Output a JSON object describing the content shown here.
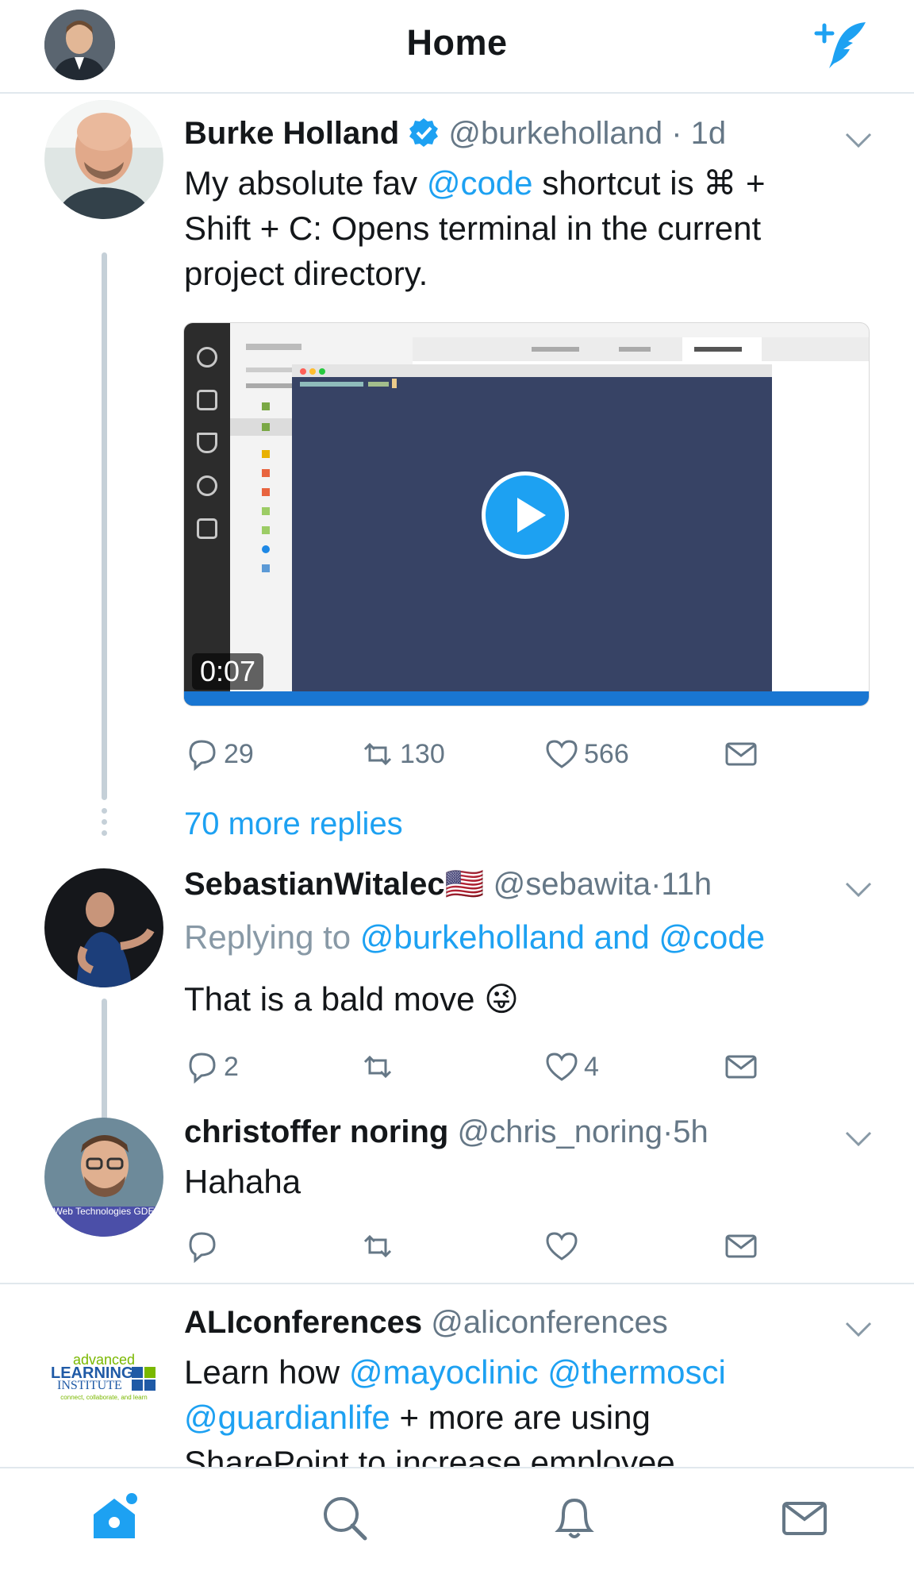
{
  "header": {
    "title": "Home"
  },
  "tweets": [
    {
      "name": "Burke Holland",
      "handle": "@burkeholland",
      "time": "1d",
      "text_parts": [
        "My absolute fav ",
        "@code",
        " shortcut is ⌘ +",
        "Shift + C: Opens terminal in the current",
        "project directory."
      ],
      "media": {
        "duration": "0:07"
      },
      "actions": {
        "replies": "29",
        "retweets": "130",
        "likes": "566"
      }
    },
    {
      "name": "SebastianWitalec🇺🇸",
      "handle": "@sebawita",
      "time": "11h",
      "replying_prefix": "Replying to ",
      "replying_to": "@burkeholland and @code",
      "text": "That is a bald move 😜",
      "actions": {
        "replies": "2",
        "retweets": "",
        "likes": "4"
      }
    },
    {
      "name": "christoffer noring",
      "handle": "@chris_noring",
      "time": "5h",
      "text": "Hahaha",
      "avatar_badge": "Web Technologies GDE",
      "actions": {
        "replies": "",
        "retweets": "",
        "likes": ""
      }
    },
    {
      "name": "ALIconferences",
      "handle": "@aliconferences",
      "text_parts": [
        "Learn how ",
        "@mayoclinic",
        " ",
        "@thermosci",
        "@guardianlife",
        " + more are using",
        "SharePoint to increase employee"
      ],
      "logo": {
        "line1": "advanced",
        "line2": "LEARNING",
        "line3": "INSTITUTE",
        "line4": "connect, collaborate, and learn"
      }
    }
  ],
  "more_replies": "70 more replies",
  "dot": "·",
  "colors": {
    "accent": "#1da1f2",
    "text": "#14171a",
    "secondary": "#657786",
    "divider": "#e1e8ed"
  },
  "tabbar": {
    "items": [
      "home-icon",
      "search-icon",
      "notifications-icon",
      "messages-icon"
    ]
  }
}
